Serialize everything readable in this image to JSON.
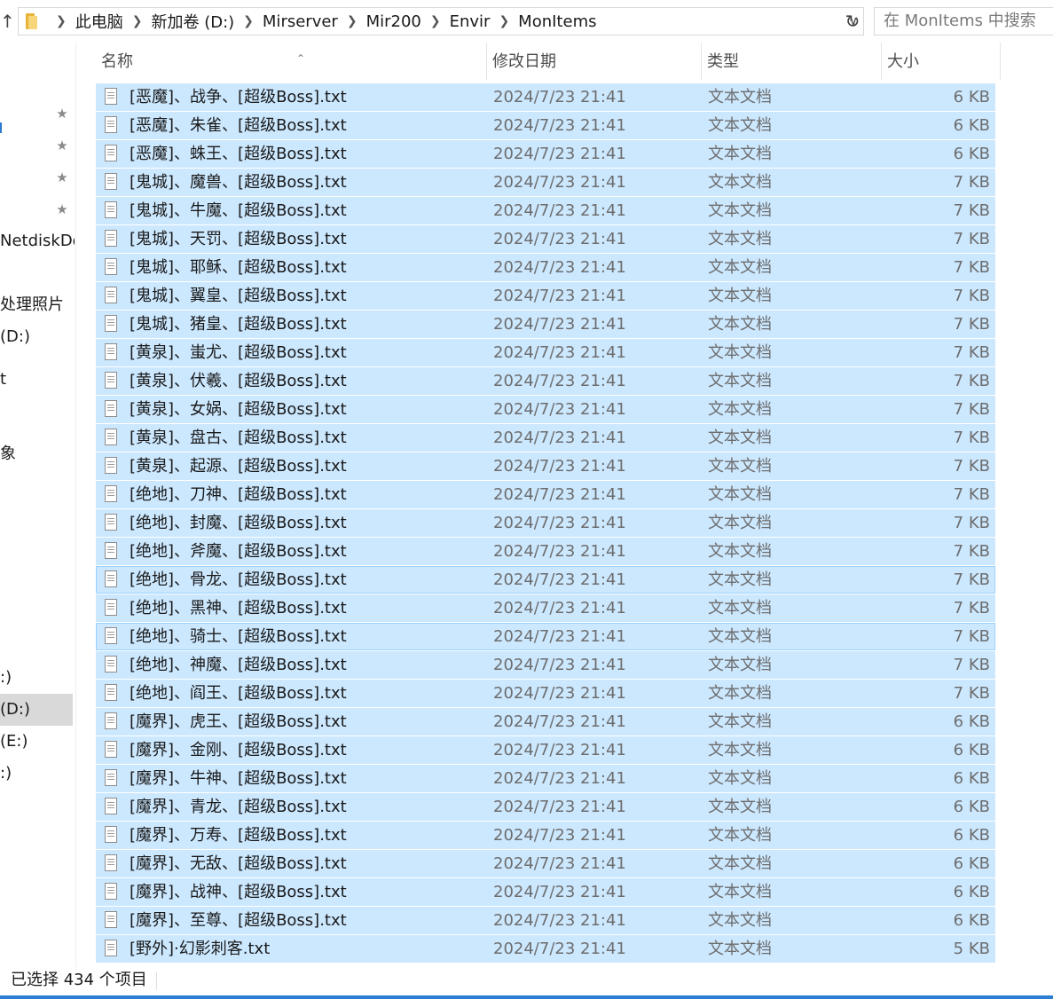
{
  "address": {
    "up_glyph": "↑",
    "crumbs": [
      "此电脑",
      "新加卷 (D:)",
      "Mirserver",
      "Mir200",
      "Envir",
      "MonItems"
    ],
    "search_placeholder": "在 MonItems 中搜索"
  },
  "sidebar": {
    "items": [
      {
        "label": "Netdisk​Do",
        "top": 0
      },
      {
        "label": "处理照片"
      },
      {
        "label": "(D:)"
      },
      {
        "label": "t"
      },
      {
        "label": "象"
      },
      {
        "label": ":)"
      },
      {
        "label": "(D:)"
      },
      {
        "label": "(E:)"
      },
      {
        "label": ":)"
      }
    ]
  },
  "columns": {
    "name": "名称",
    "date": "修改日期",
    "type": "类型",
    "size": "大小"
  },
  "files": [
    {
      "name": "[恶魔]、战争、[超级Boss].txt",
      "date": "2024/7/23 21:41",
      "type": "文本文档",
      "size": "6 KB"
    },
    {
      "name": "[恶魔]、朱雀、[超级Boss].txt",
      "date": "2024/7/23 21:41",
      "type": "文本文档",
      "size": "6 KB"
    },
    {
      "name": "[恶魔]、蛛王、[超级Boss].txt",
      "date": "2024/7/23 21:41",
      "type": "文本文档",
      "size": "6 KB"
    },
    {
      "name": "[鬼城]、魔兽、[超级Boss].txt",
      "date": "2024/7/23 21:41",
      "type": "文本文档",
      "size": "7 KB"
    },
    {
      "name": "[鬼城]、牛魔、[超级Boss].txt",
      "date": "2024/7/23 21:41",
      "type": "文本文档",
      "size": "7 KB"
    },
    {
      "name": "[鬼城]、天罚、[超级Boss].txt",
      "date": "2024/7/23 21:41",
      "type": "文本文档",
      "size": "7 KB"
    },
    {
      "name": "[鬼城]、耶稣、[超级Boss].txt",
      "date": "2024/7/23 21:41",
      "type": "文本文档",
      "size": "7 KB"
    },
    {
      "name": "[鬼城]、翼皇、[超级Boss].txt",
      "date": "2024/7/23 21:41",
      "type": "文本文档",
      "size": "7 KB"
    },
    {
      "name": "[鬼城]、猪皇、[超级Boss].txt",
      "date": "2024/7/23 21:41",
      "type": "文本文档",
      "size": "7 KB"
    },
    {
      "name": "[黄泉]、蚩尤、[超级Boss].txt",
      "date": "2024/7/23 21:41",
      "type": "文本文档",
      "size": "7 KB"
    },
    {
      "name": "[黄泉]、伏羲、[超级Boss].txt",
      "date": "2024/7/23 21:41",
      "type": "文本文档",
      "size": "7 KB"
    },
    {
      "name": "[黄泉]、女娲、[超级Boss].txt",
      "date": "2024/7/23 21:41",
      "type": "文本文档",
      "size": "7 KB"
    },
    {
      "name": "[黄泉]、盘古、[超级Boss].txt",
      "date": "2024/7/23 21:41",
      "type": "文本文档",
      "size": "7 KB"
    },
    {
      "name": "[黄泉]、起源、[超级Boss].txt",
      "date": "2024/7/23 21:41",
      "type": "文本文档",
      "size": "7 KB"
    },
    {
      "name": "[绝地]、刀神、[超级Boss].txt",
      "date": "2024/7/23 21:41",
      "type": "文本文档",
      "size": "7 KB"
    },
    {
      "name": "[绝地]、封魔、[超级Boss].txt",
      "date": "2024/7/23 21:41",
      "type": "文本文档",
      "size": "7 KB"
    },
    {
      "name": "[绝地]、斧魔、[超级Boss].txt",
      "date": "2024/7/23 21:41",
      "type": "文本文档",
      "size": "7 KB"
    },
    {
      "name": "[绝地]、骨龙、[超级Boss].txt",
      "date": "2024/7/23 21:41",
      "type": "文本文档",
      "size": "7 KB"
    },
    {
      "name": "[绝地]、黑神、[超级Boss].txt",
      "date": "2024/7/23 21:41",
      "type": "文本文档",
      "size": "7 KB"
    },
    {
      "name": "[绝地]、骑士、[超级Boss].txt",
      "date": "2024/7/23 21:41",
      "type": "文本文档",
      "size": "7 KB"
    },
    {
      "name": "[绝地]、神魔、[超级Boss].txt",
      "date": "2024/7/23 21:41",
      "type": "文本文档",
      "size": "7 KB"
    },
    {
      "name": "[绝地]、阎王、[超级Boss].txt",
      "date": "2024/7/23 21:41",
      "type": "文本文档",
      "size": "7 KB"
    },
    {
      "name": "[魔界]、虎王、[超级Boss].txt",
      "date": "2024/7/23 21:41",
      "type": "文本文档",
      "size": "6 KB"
    },
    {
      "name": "[魔界]、金刚、[超级Boss].txt",
      "date": "2024/7/23 21:41",
      "type": "文本文档",
      "size": "6 KB"
    },
    {
      "name": "[魔界]、牛神、[超级Boss].txt",
      "date": "2024/7/23 21:41",
      "type": "文本文档",
      "size": "6 KB"
    },
    {
      "name": "[魔界]、青龙、[超级Boss].txt",
      "date": "2024/7/23 21:41",
      "type": "文本文档",
      "size": "6 KB"
    },
    {
      "name": "[魔界]、万寿、[超级Boss].txt",
      "date": "2024/7/23 21:41",
      "type": "文本文档",
      "size": "6 KB"
    },
    {
      "name": "[魔界]、无敌、[超级Boss].txt",
      "date": "2024/7/23 21:41",
      "type": "文本文档",
      "size": "6 KB"
    },
    {
      "name": "[魔界]、战神、[超级Boss].txt",
      "date": "2024/7/23 21:41",
      "type": "文本文档",
      "size": "6 KB"
    },
    {
      "name": "[魔界]、至尊、[超级Boss].txt",
      "date": "2024/7/23 21:41",
      "type": "文本文档",
      "size": "6 KB"
    },
    {
      "name": "[野外]·幻影刺客.txt",
      "date": "2024/7/23 21:41",
      "type": "文本文档",
      "size": "5 KB"
    }
  ],
  "status": {
    "selection": "已选择 434 个项目"
  },
  "colors": {
    "selection": "#cce8ff",
    "selection_border": "#99d1ff",
    "accent": "#2a7fd4"
  }
}
